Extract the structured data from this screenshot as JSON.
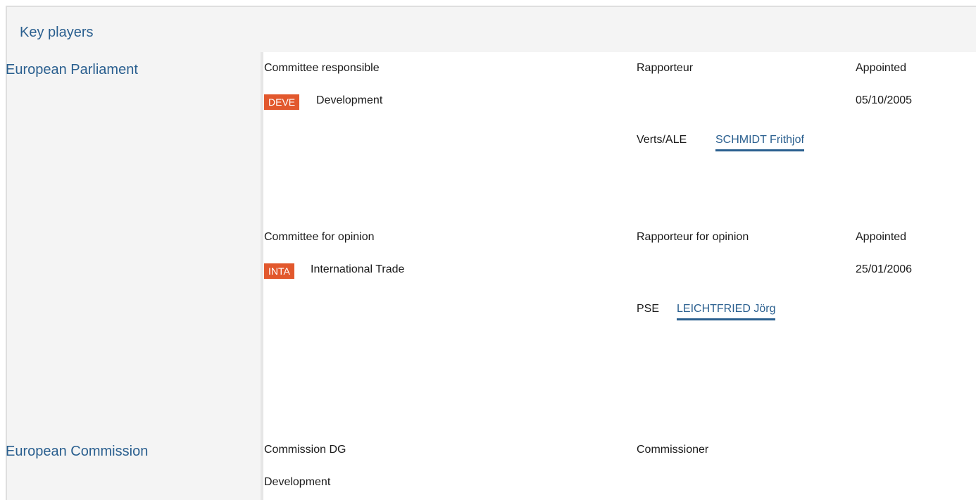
{
  "header": {
    "title": "Key players"
  },
  "sections": [
    {
      "title": "European Parliament",
      "blocks": [
        {
          "committee_label": "Committee responsible",
          "rapporteur_label": "Rapporteur",
          "appointed_label": "Appointed",
          "committee_code": "DEVE",
          "committee_name": "Development",
          "appointed_date": "05/10/2005",
          "group": "Verts/ALE",
          "person": "SCHMIDT Frithjof"
        },
        {
          "committee_label": "Committee for opinion",
          "rapporteur_label": "Rapporteur for opinion",
          "appointed_label": "Appointed",
          "committee_code": "INTA",
          "committee_name": "International Trade",
          "appointed_date": "25/01/2006",
          "group": "PSE",
          "person": "LEICHTFRIED Jörg"
        }
      ]
    },
    {
      "title": "European Commission",
      "dg_label": "Commission DG",
      "commissioner_label": "Commissioner",
      "dg_value": "Development"
    }
  ],
  "colors": {
    "accent": "#2a5f8f",
    "badge": "#e2582d",
    "panel": "#f4f4f4"
  }
}
